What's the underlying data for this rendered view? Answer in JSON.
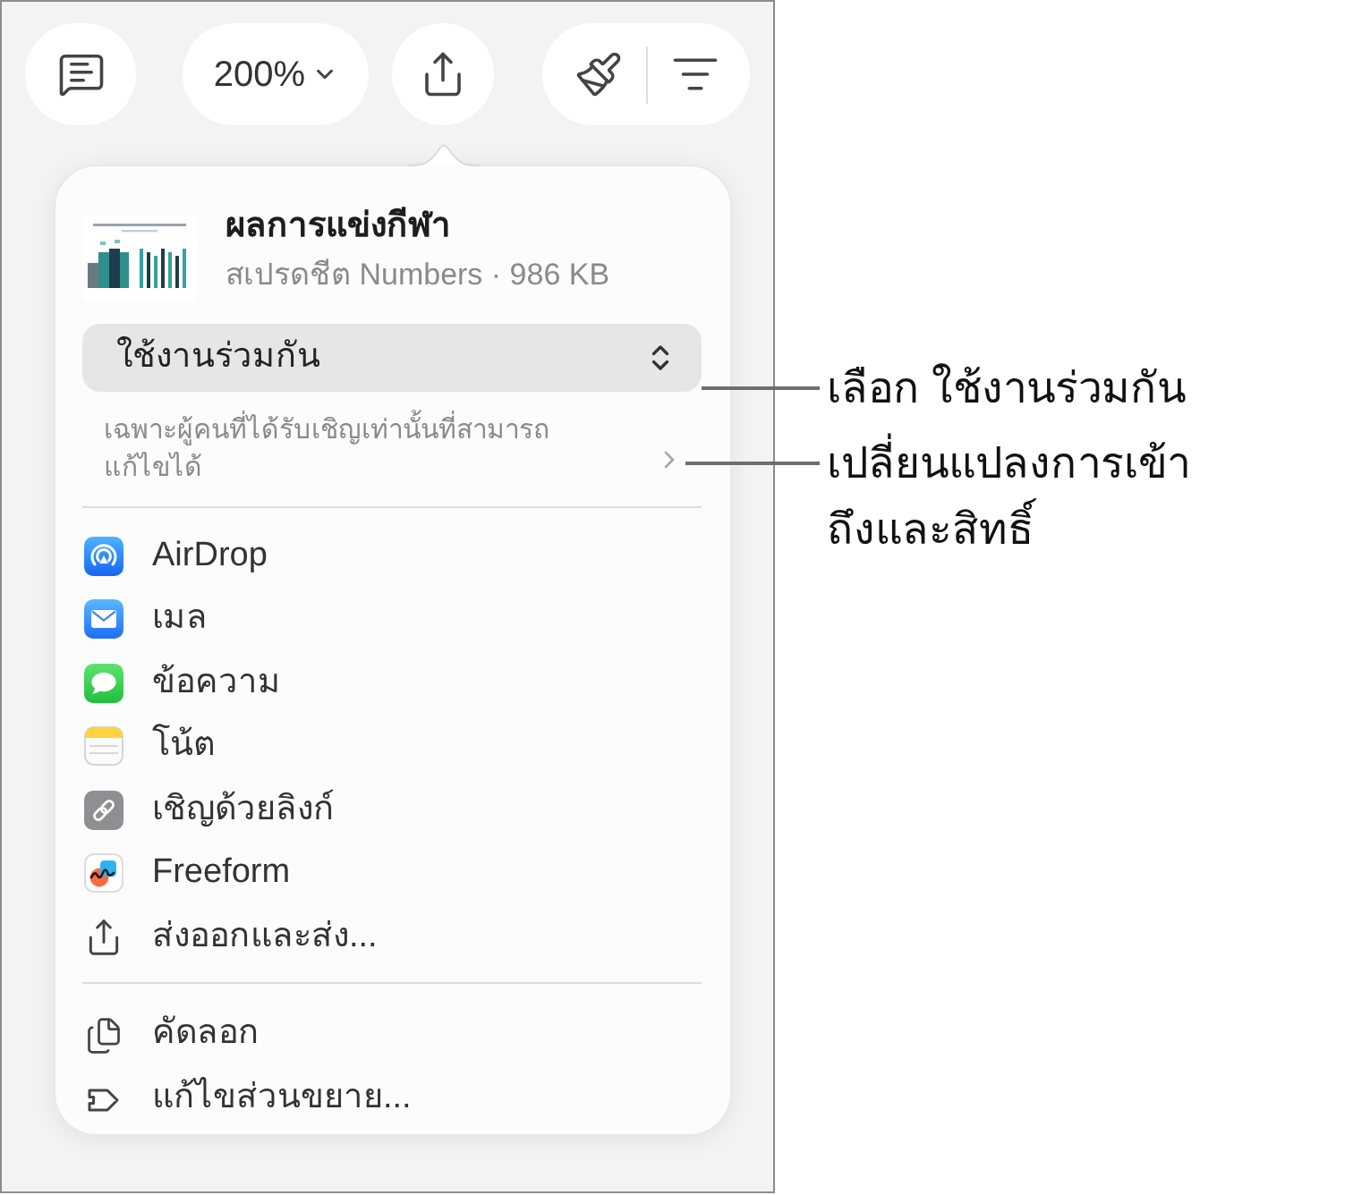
{
  "toolbar": {
    "zoom": "200%"
  },
  "share_sheet": {
    "file": {
      "title": "ผลการแข่งกีฬา",
      "subtitle": "สเปรดชีต Numbers · 986 KB"
    },
    "collaboration": {
      "value": "ใช้งานร่วมกัน"
    },
    "permissions": {
      "lines": [
        "เฉพาะผู้คนที่ได้รับเชิญเท่านั้นที่สามารถ",
        "แก้ไขได้"
      ]
    },
    "share_options": [
      {
        "label": "AirDrop",
        "kind": "app"
      },
      {
        "label": "เมล",
        "kind": "app"
      },
      {
        "label": "ข้อความ",
        "kind": "app"
      },
      {
        "label": "โน้ต",
        "kind": "app"
      },
      {
        "label": "เชิญด้วยลิงก์",
        "kind": "app"
      },
      {
        "label": "Freeform",
        "kind": "app"
      },
      {
        "label": "ส่งออกและส่ง...",
        "kind": "action"
      }
    ],
    "actions": [
      {
        "label": "คัดลอก"
      },
      {
        "label": "แก้ไขส่วนขยาย..."
      }
    ]
  },
  "callouts": [
    {
      "lines": [
        "เลือก ใช้งานร่วมกัน"
      ]
    },
    {
      "lines": [
        "เปลี่ยนแปลงการเข้า",
        "ถึงและสิทธิ์"
      ]
    }
  ]
}
